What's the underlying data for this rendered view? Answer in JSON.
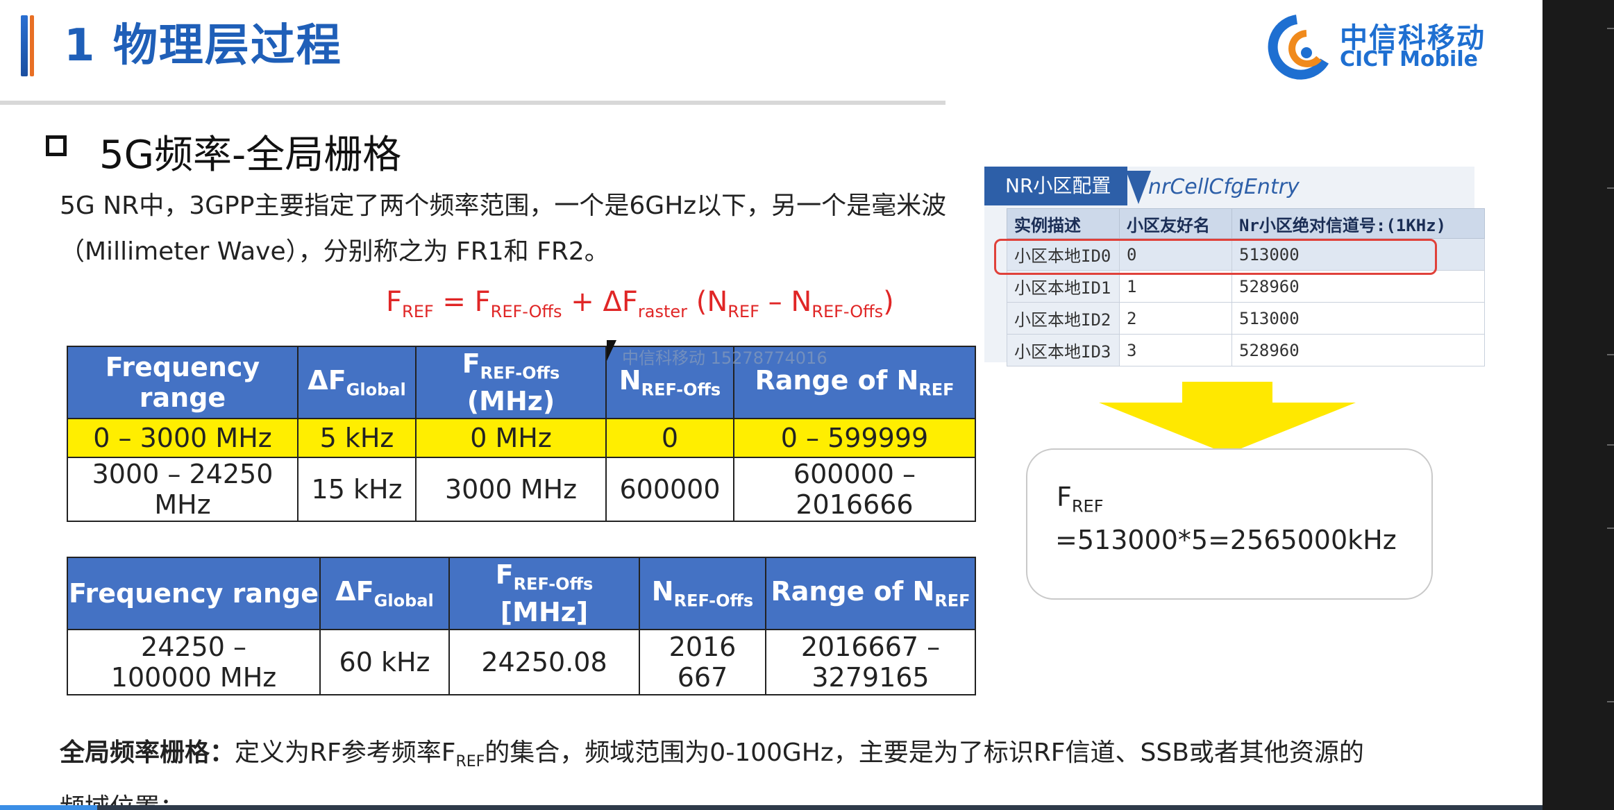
{
  "header": {
    "title": "1 物理层过程",
    "logo_cn": "中信科移动",
    "logo_en": "CICT Mobile"
  },
  "section": {
    "title": "5G频率-全局栅格",
    "paragraph": "5G NR中，3GPP主要指定了两个频率范围，一个是6GHz以下，另一个是毫米波（Millimeter Wave），分别称之为 FR1和 FR2。"
  },
  "formula": {
    "lhs": "F",
    "lhs_sub": "REF",
    "eq": " = ",
    "t1": "F",
    "t1_sub": "REF-Offs",
    "plus": " + ΔF",
    "t2_sub": "raster",
    "paren_open": " (N",
    "t3_sub": "REF",
    "minus": " – N",
    "t4_sub": "REF-Offs",
    "paren_close": ")"
  },
  "table1": {
    "headers": {
      "c1": "Frequency range",
      "c2": "ΔF",
      "c2_sub": "Global",
      "c3": "F",
      "c3_sub": "REF-Offs",
      "c3_unit": "(MHz)",
      "c4": "N",
      "c4_sub": "REF-Offs",
      "c5": "Range of N",
      "c5_sub": "REF"
    },
    "rows": [
      [
        "0 – 3000 MHz",
        "5 kHz",
        "0 MHz",
        "0",
        "0 – 599999"
      ],
      [
        "3000 – 24250 MHz",
        "15 kHz",
        "3000 MHz",
        "600000",
        "600000 – 2016666"
      ]
    ]
  },
  "table2": {
    "headers": {
      "c1": "Frequency range",
      "c2": "ΔF",
      "c2_sub": "Global",
      "c3": "F",
      "c3_sub": "REF-Offs",
      "c3_unit": "[MHz]",
      "c4": "N",
      "c4_sub": "REF-Offs",
      "c5": "Range of N",
      "c5_sub": "REF"
    },
    "rows": [
      [
        "24250 – 100000 MHz",
        "60 kHz",
        "24250.08",
        "2016667",
        "2016667 – 3279165"
      ]
    ]
  },
  "config_panel": {
    "tab": "NR小区配置",
    "entry": "nrCellCfgEntry",
    "columns": [
      "实例描述",
      "小区友好名",
      "Nr小区绝对信道号:(1KHz)"
    ],
    "rows": [
      [
        "小区本地ID0",
        "0",
        "513000"
      ],
      [
        "小区本地ID1",
        "1",
        "528960"
      ],
      [
        "小区本地ID2",
        "2",
        "513000"
      ],
      [
        "小区本地ID3",
        "3",
        "528960"
      ]
    ]
  },
  "callout": {
    "label": "F",
    "label_sub": "REF",
    "calc": "=513000*5=2565000kHz"
  },
  "bottom": {
    "bold": "全局频率栅格：",
    "text_a": "定义为RF参考频率F",
    "sub": "REF",
    "text_b": "的集合，频域范围为0-100GHz，主要是为了标识RF信道、SSB或者其他资源的",
    "text_c": "频域位置；"
  },
  "watermark": "中信科移动 15278774016",
  "colors": {
    "title_blue": "#1f5fb8",
    "table_header": "#4472c4",
    "highlight_row": "#ffee00",
    "formula_red": "#e02626",
    "selection_red": "#e0413a"
  }
}
